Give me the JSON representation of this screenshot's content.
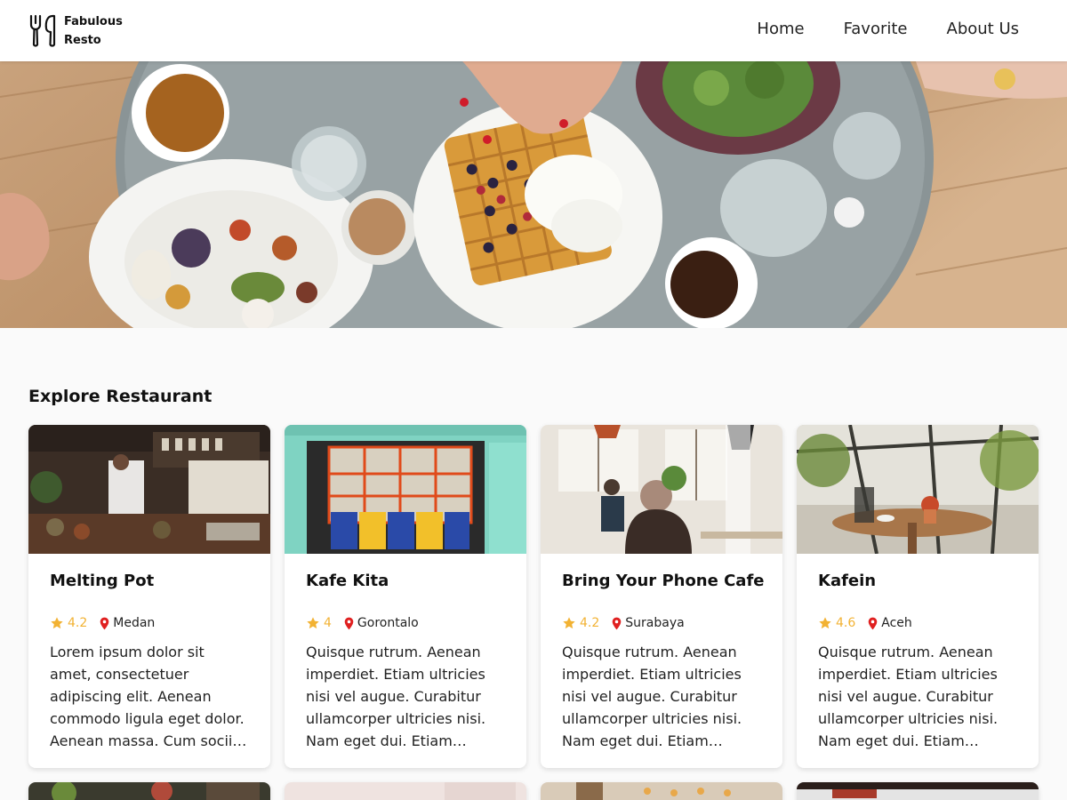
{
  "header": {
    "logo_line1": "Fabulous",
    "logo_line2": "Resto",
    "logo_icon": "fork-spoon-icon",
    "nav": [
      {
        "label": "Home"
      },
      {
        "label": "Favorite"
      },
      {
        "label": "About Us"
      }
    ]
  },
  "section": {
    "title": "Explore Restaurant"
  },
  "restaurants": [
    {
      "name": "Melting Pot",
      "rating": "4.2",
      "city": "Medan",
      "description": "Lorem ipsum dolor sit amet, consectetuer adipiscing elit. Aenean commodo ligula eget dolor. Aenean massa. Cum sociis natoque penatibus et magnis dis parturient montes."
    },
    {
      "name": "Kafe Kita",
      "rating": "4",
      "city": "Gorontalo",
      "description": "Quisque rutrum. Aenean imperdiet. Etiam ultricies nisi vel augue. Curabitur ullamcorper ultricies nisi. Nam eget dui. Etiam rhoncus. Maecenas tempus, tellus eget condimentum rhoncus."
    },
    {
      "name": "Bring Your Phone Cafe",
      "rating": "4.2",
      "city": "Surabaya",
      "description": "Quisque rutrum. Aenean imperdiet. Etiam ultricies nisi vel augue. Curabitur ullamcorper ultricies nisi. Nam eget dui. Etiam rhoncus. Maecenas tempus, tellus eget condimentum rhoncus."
    },
    {
      "name": "Kafein",
      "rating": "4.6",
      "city": "Aceh",
      "description": "Quisque rutrum. Aenean imperdiet. Etiam ultricies nisi vel augue. Curabitur ullamcorper ultricies nisi. Nam eget dui. Etiam rhoncus. Maecenas tempus, tellus eget condimentum rhoncus."
    }
  ],
  "icons": {
    "rating": "star-icon",
    "location": "map-pin-icon"
  },
  "colors": {
    "star": "#f2b233",
    "pin": "#e02020"
  }
}
